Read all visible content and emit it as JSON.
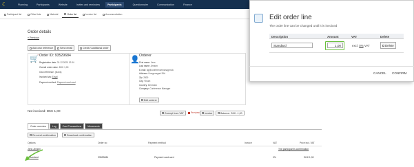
{
  "topnav": {
    "items": [
      "Planning",
      "Participants",
      "Website",
      "Invites and reminders",
      "Participants",
      "Questionnaire",
      "Communication",
      "Finance"
    ],
    "active_index": 4
  },
  "subnav": {
    "items": [
      "Participant list",
      "Other lists",
      "Material",
      "Order list",
      "Invoice list",
      "Accommodation"
    ],
    "active_index": 3
  },
  "page": {
    "title": "Order details",
    "back_link": "« Previous"
  },
  "toolbar": {
    "add_reference": "Add own reference",
    "send_email": "Send email",
    "credit_order": "Credit / Additional order"
  },
  "order_card": {
    "heading": "Order ID: 93529684",
    "rows": [
      {
        "k": "Registration date:",
        "v": "31.12.2020 12:34"
      },
      {
        "k": "Overall order value:",
        "v": "DKK 1,00"
      },
      {
        "k": "Own reference:",
        "v": "(blank)"
      },
      {
        "k": "Invoiced via:",
        "v": "Email"
      },
      {
        "k": "Payment method:",
        "v": "Payment card card"
      }
    ]
  },
  "orderer_card": {
    "heading": "Orderer",
    "rows": [
      {
        "k": "First name:",
        "v": "Jens"
      },
      {
        "k": "Last name:",
        "v": "Jensen"
      },
      {
        "k": "E-mail:",
        "v": "kg@conferencemanager.dk"
      },
      {
        "k": "Address:",
        "v": "Kongensgart 26#"
      },
      {
        "k": "Zip:",
        "v": "2800"
      },
      {
        "k": "City:",
        "v": "Vinum"
      },
      {
        "k": "Country:",
        "v": "Denmark"
      },
      {
        "k": "Company:",
        "v": "Conference Manager"
      }
    ],
    "edit_button": "Edit orderer"
  },
  "status_bar": {
    "not_invoiced": "Not invoiced: DKK 1,00",
    "exempt": "Exempt from VAT",
    "preview": "Preview",
    "invoice": "Invoice",
    "balance": "Balance: DKK -1,00"
  },
  "tabs": [
    "Order overview",
    "Log",
    "Card Transactions",
    "Movements"
  ],
  "confirm": {
    "re_send": "Re-send confirmation",
    "download": "Download confirmation"
  },
  "table": {
    "headers": [
      "Options",
      "Order no",
      "Payment method",
      "Invoice",
      "VAT",
      "Price incl. VAT"
    ],
    "participant": "Jens Jensen",
    "participant_link": "The participant's confirmation",
    "item": {
      "name": "Standard",
      "order_no": "93529684",
      "payment": "Payment card card",
      "invoice": "",
      "vat": "0%",
      "price": "DKK 1,00"
    }
  },
  "dialog": {
    "title": "Edit order line",
    "subtitle": "The order line can be changed until it is invoiced",
    "headers": [
      "Description",
      "Amount",
      "VAT",
      "Delete"
    ],
    "description_value": "Standard",
    "amount_value": "1,00",
    "vat_text_pre": "excl.",
    "vat_pct": "0%",
    "vat_text_post": "VAT",
    "delete_label": "Delete",
    "cancel_label": "CANCEL",
    "confirm_label": "CONFIRM"
  },
  "colors": {
    "nav_bg": "#15304f",
    "accent": "#2c4a70",
    "highlight": "#6abf3c",
    "preview": "#c0392b"
  }
}
